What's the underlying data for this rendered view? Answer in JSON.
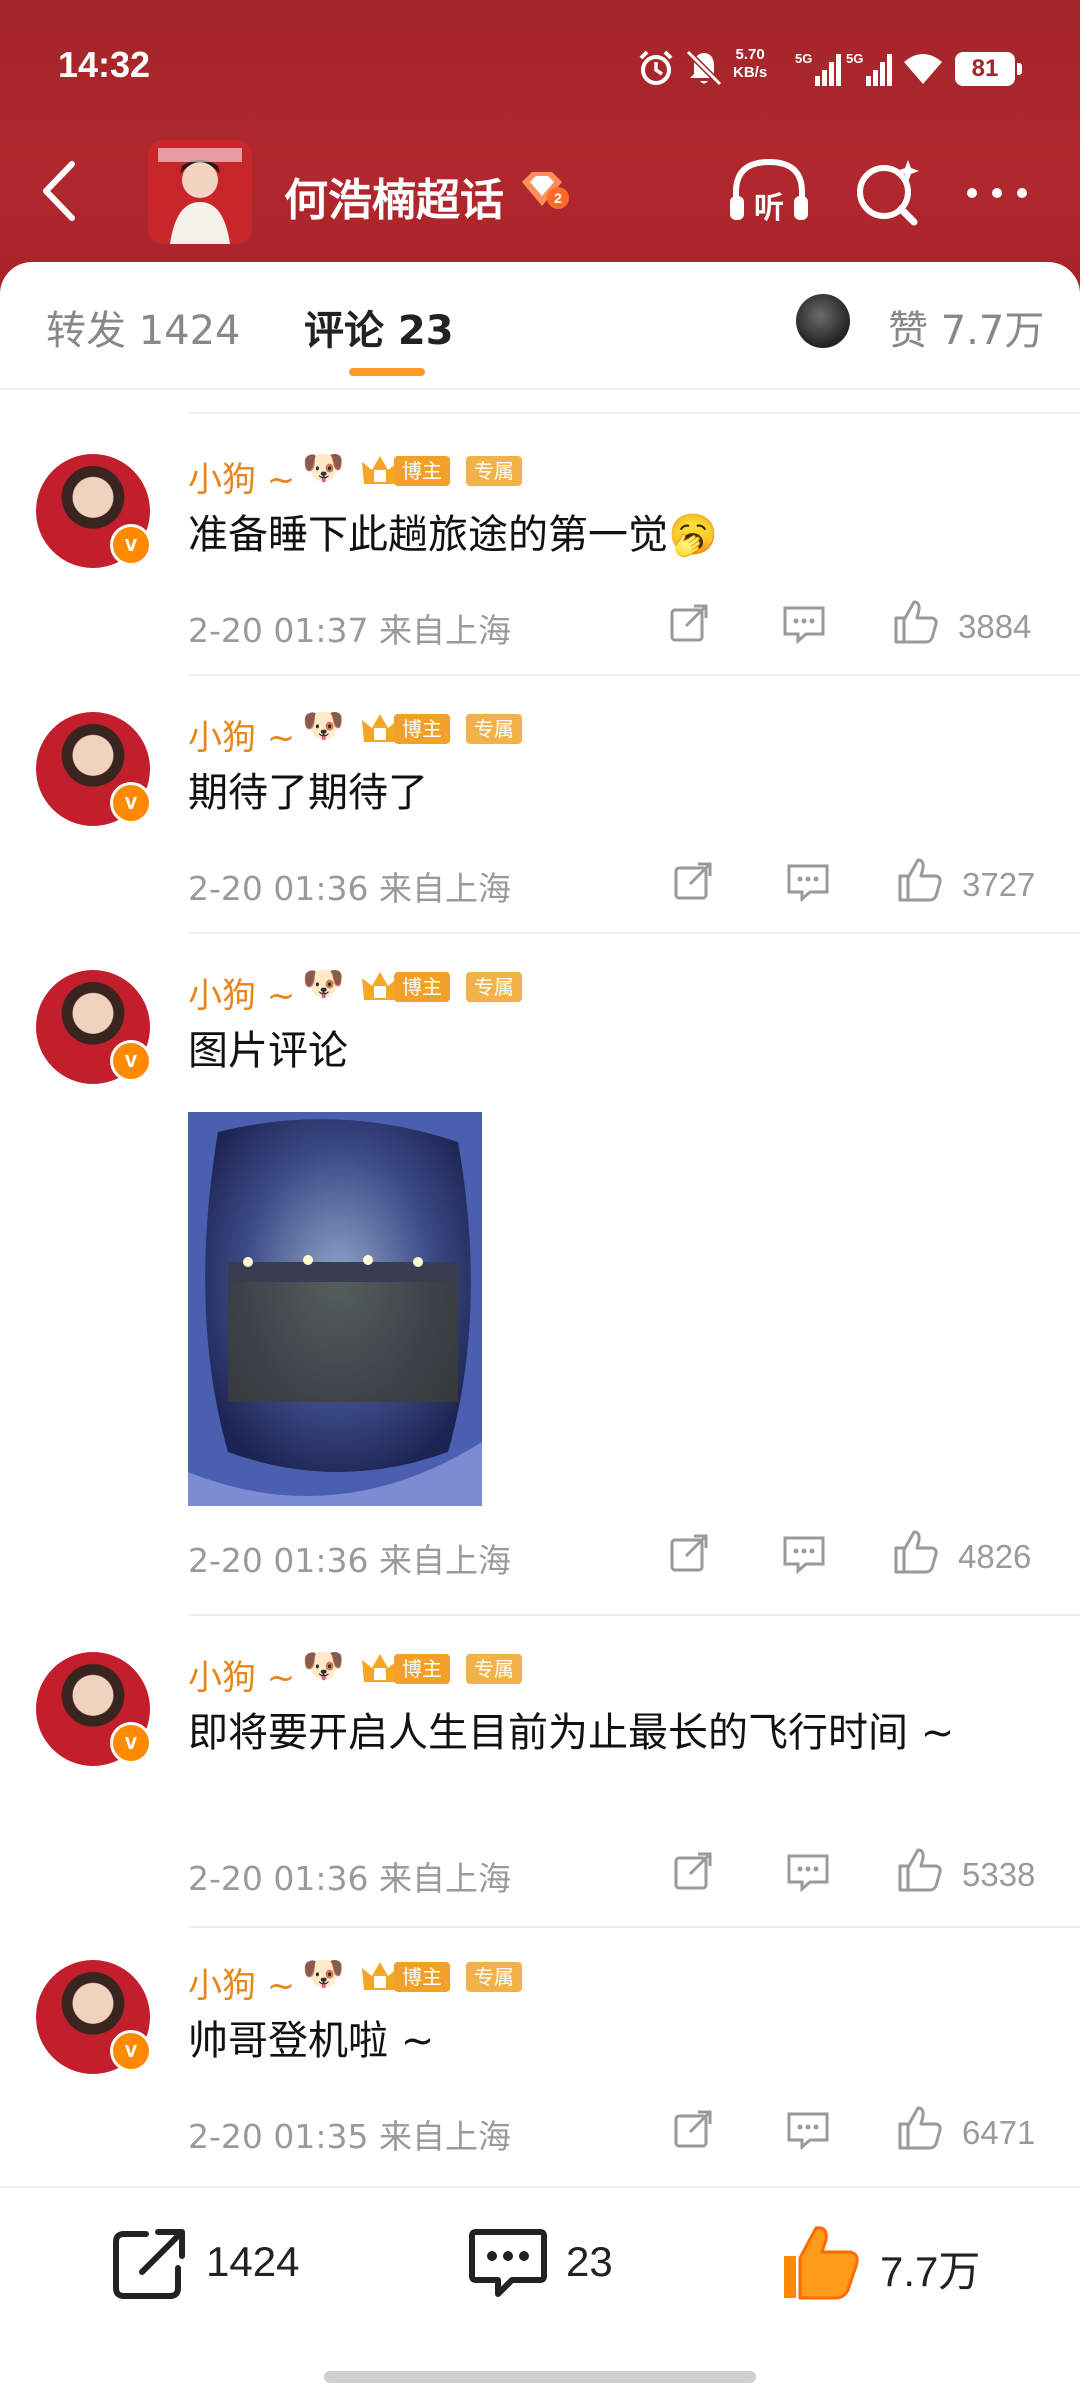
{
  "status": {
    "time": "14:32",
    "net_speed_value": "5.70",
    "net_speed_unit": "KB/s",
    "signal_1": "5G",
    "signal_2": "5G",
    "battery": "81"
  },
  "header": {
    "topic_title": "何浩楠超话",
    "topic_level": "2",
    "listen_label": "听"
  },
  "tabs": {
    "repost": "转发 1424",
    "comment": "评论 23",
    "likes": "赞 7.7万"
  },
  "colors": {
    "brand_red": "#a3262a",
    "username_orange": "#e8851a",
    "tab_underline": "#ff9a2a",
    "like_orange": "#ff8a00"
  },
  "comments": [
    {
      "user": "小狗 ~",
      "emoji": "🐶",
      "tag_blogger": "博主",
      "tag_exclusive": "专属",
      "text": "准备睡下此趟旅途的第一觉🥱",
      "time": "2-20 01:37",
      "location": "来自上海",
      "likes": "3884"
    },
    {
      "user": "小狗 ~",
      "emoji": "🐶",
      "tag_blogger": "博主",
      "tag_exclusive": "专属",
      "text": "期待了期待了",
      "time": "2-20 01:36",
      "location": "来自上海",
      "likes": "3727"
    },
    {
      "user": "小狗 ~",
      "emoji": "🐶",
      "tag_blogger": "博主",
      "tag_exclusive": "专属",
      "text": "图片评论",
      "time": "2-20 01:36",
      "location": "来自上海",
      "likes": "4826"
    },
    {
      "user": "小狗 ~",
      "emoji": "🐶",
      "tag_blogger": "博主",
      "tag_exclusive": "专属",
      "text": "即将要开启人生目前为止最长的飞行时间 ~",
      "time": "2-20 01:36",
      "location": "来自上海",
      "likes": "5338"
    },
    {
      "user": "小狗 ~",
      "emoji": "🐶",
      "tag_blogger": "博主",
      "tag_exclusive": "专属",
      "text": "帅哥登机啦 ~",
      "time": "2-20 01:35",
      "location": "来自上海",
      "likes": "6471"
    }
  ],
  "bottom_bar": {
    "repost_count": "1424",
    "comment_count": "23",
    "like_count": "7.7万"
  }
}
